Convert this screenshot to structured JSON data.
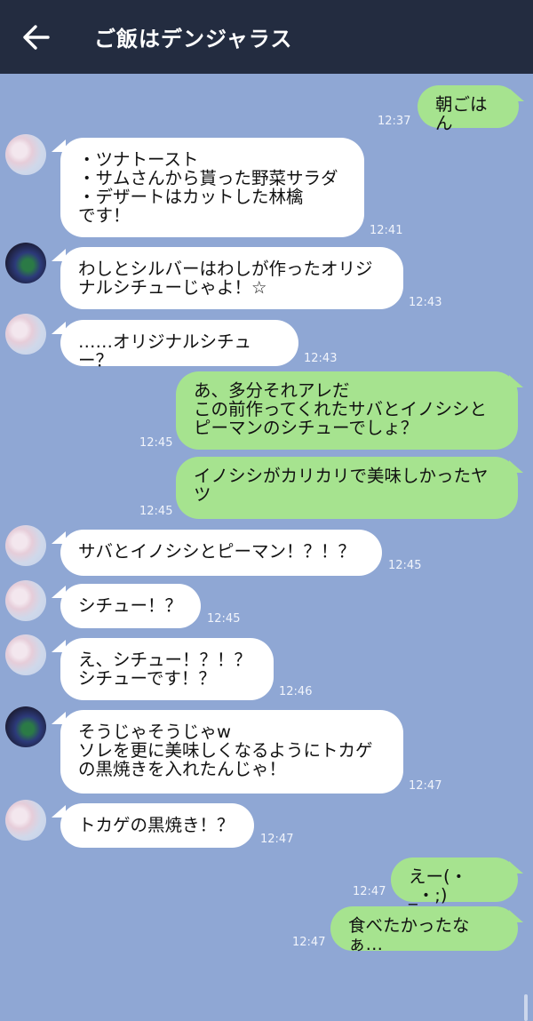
{
  "header": {
    "back_icon": "arrow-left-icon",
    "title": "ご飯はデンジャラス"
  },
  "colors": {
    "header_bg": "#232c40",
    "chat_bg": "#8fa7d4",
    "bubble_in": "#ffffff",
    "bubble_out": "#a6e38f"
  },
  "messages": [
    {
      "sender": "me",
      "text": "朝ごはん",
      "time": "12:37"
    },
    {
      "sender": "blossom",
      "text": "・ツナトースト\n・サムさんから貰った野菜サラダ\n・デザートはカットした林檎\nです！",
      "time": "12:41"
    },
    {
      "sender": "dark",
      "text": "わしとシルバーはわしが作ったオリジ\nナルシチューじゃよ！☆",
      "time": "12:43"
    },
    {
      "sender": "blossom",
      "text": "……オリジナルシチュー？",
      "time": "12:43"
    },
    {
      "sender": "me",
      "text": "あ、多分それアレだ\nこの前作ってくれたサバとイノシシと\nピーマンのシチューでしょ？",
      "time": "12:45"
    },
    {
      "sender": "me",
      "text": "イノシシがカリカリで美味しかったヤ\nツ",
      "time": "12:45"
    },
    {
      "sender": "blossom",
      "text": "サバとイノシシとピーマン！？！？",
      "time": "12:45"
    },
    {
      "sender": "blossom",
      "text": "シチュー！？",
      "time": "12:45"
    },
    {
      "sender": "blossom",
      "text": "え、シチュー！？！？\nシチューです！？",
      "time": "12:46"
    },
    {
      "sender": "dark",
      "text": "そうじゃそうじゃw\nソレを更に美味しくなるようにトカゲ\nの黒焼きを入れたんじゃ！",
      "time": "12:47"
    },
    {
      "sender": "blossom",
      "text": "トカゲの黒焼き！？",
      "time": "12:47"
    },
    {
      "sender": "me",
      "text": "えー(・_・;)",
      "time": "12:47"
    },
    {
      "sender": "me",
      "text": "食べたかったなぁ…",
      "time": "12:47"
    }
  ]
}
